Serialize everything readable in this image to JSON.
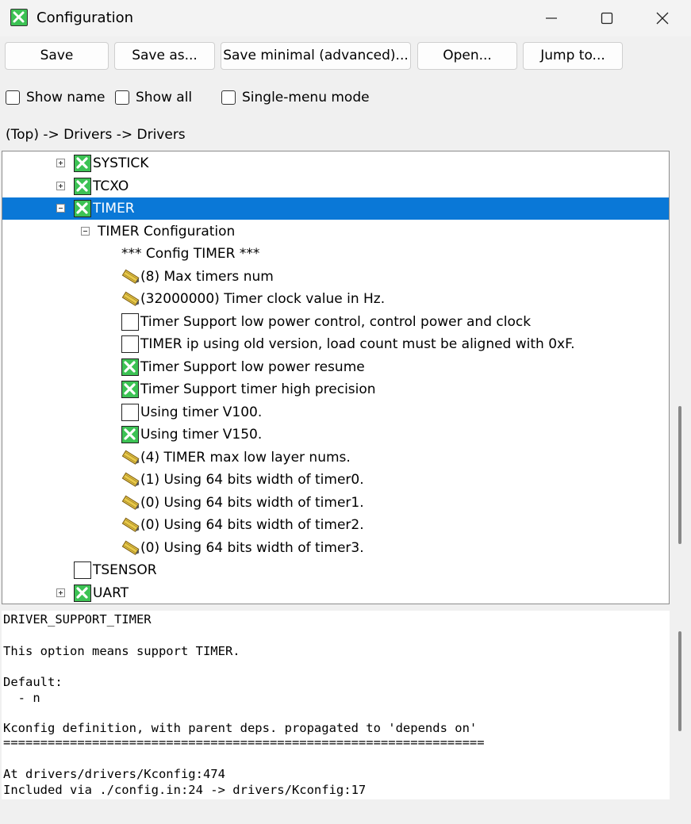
{
  "window": {
    "title": "Configuration"
  },
  "toolbar": {
    "save": "Save",
    "save_as": "Save as...",
    "save_minimal": "Save minimal (advanced)...",
    "open": "Open...",
    "jump_to": "Jump to..."
  },
  "options": {
    "show_name": {
      "label": "Show name",
      "checked": false
    },
    "show_all": {
      "label": "Show all",
      "checked": false
    },
    "single_menu": {
      "label": "Single-menu mode",
      "checked": false
    }
  },
  "breadcrumb": "(Top) -> Drivers -> Drivers",
  "tree": {
    "items": [
      {
        "label": "SYSTICK",
        "kind": "bool",
        "checked": true,
        "expander": "plus",
        "selected": false
      },
      {
        "label": "TCXO",
        "kind": "bool",
        "checked": true,
        "expander": "plus",
        "selected": false
      },
      {
        "label": "TIMER",
        "kind": "bool",
        "checked": true,
        "expander": "minus",
        "selected": true
      },
      {
        "label": "TIMER Configuration",
        "kind": "menu",
        "expander": "minus",
        "selected": false
      },
      {
        "label": "*** Config TIMER ***",
        "kind": "comment",
        "selected": false
      },
      {
        "label": "(8) Max timers num",
        "kind": "value",
        "selected": false
      },
      {
        "label": "(32000000) Timer clock value in Hz.",
        "kind": "value",
        "selected": false
      },
      {
        "label": "Timer Support low power control, control power and clock",
        "kind": "bool",
        "checked": false,
        "selected": false
      },
      {
        "label": "TIMER ip using old version, load count must be aligned with 0xF.",
        "kind": "bool",
        "checked": false,
        "selected": false
      },
      {
        "label": "Timer Support low power resume",
        "kind": "bool",
        "checked": true,
        "selected": false
      },
      {
        "label": "Timer Support timer high precision",
        "kind": "bool",
        "checked": true,
        "selected": false
      },
      {
        "label": "Using timer V100.",
        "kind": "bool",
        "checked": false,
        "selected": false
      },
      {
        "label": "Using timer V150.",
        "kind": "bool",
        "checked": true,
        "selected": false
      },
      {
        "label": "(4) TIMER max low layer nums.",
        "kind": "value",
        "selected": false
      },
      {
        "label": "(1) Using 64 bits width of timer0.",
        "kind": "value",
        "selected": false
      },
      {
        "label": "(0) Using 64 bits width of timer1.",
        "kind": "value",
        "selected": false
      },
      {
        "label": "(0) Using 64 bits width of timer2.",
        "kind": "value",
        "selected": false
      },
      {
        "label": "(0) Using 64 bits width of timer3.",
        "kind": "value",
        "selected": false
      },
      {
        "label": "TSENSOR",
        "kind": "bool",
        "checked": false,
        "selected": false
      },
      {
        "label": "UART",
        "kind": "bool",
        "checked": true,
        "expander": "plus",
        "selected": false
      }
    ]
  },
  "description": {
    "symbol": "DRIVER_SUPPORT_TIMER",
    "help": "This option means support TIMER.",
    "default_label": "Default:",
    "default_value": "  - n",
    "kconfig_heading": "Kconfig definition, with parent deps. propagated to 'depends on'",
    "separator": "=================================================================",
    "location": "At drivers/drivers/Kconfig:474",
    "included_via": "Included via ./config.in:24 -> drivers/Kconfig:17"
  },
  "colors": {
    "selection": "#0a78d7",
    "checked_box": "#3cc254",
    "check_mark": "#ffffff"
  }
}
